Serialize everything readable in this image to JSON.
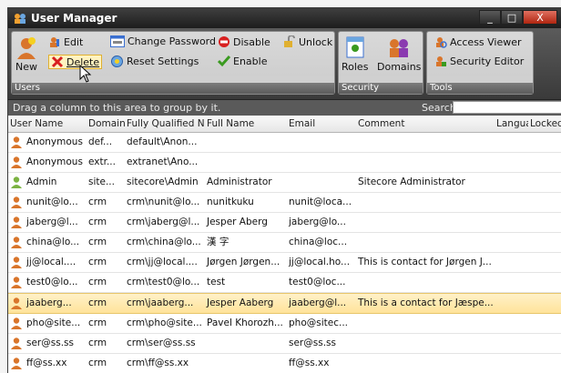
{
  "window": {
    "title": "User Manager",
    "controls": {
      "minimize": "_",
      "maximize": "□",
      "close": "X"
    }
  },
  "ribbon": {
    "users_group": {
      "label": "Users",
      "new": "New",
      "edit": "Edit",
      "delete": "Delete",
      "change_password": "Change Password",
      "reset_settings": "Reset Settings",
      "disable": "Disable",
      "enable": "Enable",
      "unlock": "Unlock"
    },
    "security_group": {
      "label": "Security",
      "roles": "Roles",
      "domains": "Domains"
    },
    "tools_group": {
      "label": "Tools",
      "access_viewer": "Access Viewer",
      "security_editor": "Security Editor"
    }
  },
  "grouping_hint": "Drag a column to this area to group by it.",
  "search": {
    "label": "Search:",
    "value": ""
  },
  "columns": [
    "User Name",
    "Domain",
    "Fully Qualified Name",
    "Full Name",
    "Email",
    "Comment",
    "Language",
    "Locked"
  ],
  "rows": [
    {
      "user": "Anonymous",
      "domain": "def...",
      "fqn": "default\\Anon...",
      "full": "",
      "email": "",
      "comment": "",
      "icon": "user-icon",
      "selected": false
    },
    {
      "user": "Anonymous",
      "domain": "extr...",
      "fqn": "extranet\\Ano...",
      "full": "",
      "email": "",
      "comment": "",
      "icon": "user-icon",
      "selected": false
    },
    {
      "user": "Admin",
      "domain": "site...",
      "fqn": "sitecore\\Admin",
      "full": "Administrator",
      "email": "",
      "comment": "Sitecore Administrator",
      "icon": "admin-user-icon",
      "selected": false
    },
    {
      "user": "nunit@lo...",
      "domain": "crm",
      "fqn": "crm\\nunit@lo...",
      "full": "nunitkuku",
      "email": "nunit@loca...",
      "comment": "",
      "icon": "user-icon",
      "selected": false
    },
    {
      "user": "jaberg@l...",
      "domain": "crm",
      "fqn": "crm\\jaberg@l...",
      "full": "Jesper Aberg",
      "email": "jaberg@lo...",
      "comment": "",
      "icon": "user-icon",
      "selected": false
    },
    {
      "user": "china@lo...",
      "domain": "crm",
      "fqn": "crm\\china@lo...",
      "full": "漢 字",
      "email": "china@loc...",
      "comment": "",
      "icon": "user-icon",
      "selected": false
    },
    {
      "user": "jj@local....",
      "domain": "crm",
      "fqn": "crm\\jj@local....",
      "full": "Jørgen Jørgen...",
      "email": "jj@local.ho...",
      "comment": "This is contact for Jørgen J...",
      "icon": "user-icon",
      "selected": false
    },
    {
      "user": "test0@lo...",
      "domain": "crm",
      "fqn": "crm\\test0@lo...",
      "full": "test",
      "email": "test0@loc...",
      "comment": "",
      "icon": "user-icon",
      "selected": false
    },
    {
      "user": "jaaberg...",
      "domain": "crm",
      "fqn": "crm\\jaaberg...",
      "full": "Jesper Aaberg",
      "email": "jaaberg@l...",
      "comment": "This is a contact for Jæspe...",
      "icon": "user-icon",
      "selected": true
    },
    {
      "user": "pho@site...",
      "domain": "crm",
      "fqn": "crm\\pho@site...",
      "full": "Pavel Khorozh...",
      "email": "pho@sitec...",
      "comment": "",
      "icon": "user-icon",
      "selected": false
    },
    {
      "user": "ser@ss.ss",
      "domain": "crm",
      "fqn": "crm\\ser@ss.ss",
      "full": "",
      "email": "ser@ss.ss",
      "comment": "",
      "icon": "user-icon",
      "selected": false
    },
    {
      "user": "ff@ss.xx",
      "domain": "crm",
      "fqn": "crm\\ff@ss.xx",
      "full": "",
      "email": "ff@ss.xx",
      "comment": "",
      "icon": "user-icon",
      "selected": false
    }
  ],
  "colors": {
    "selection": "#ffe39a",
    "ribbon": "#4a4a4a",
    "user_icon": "#d9752b",
    "admin_icon": "#7cb342"
  }
}
